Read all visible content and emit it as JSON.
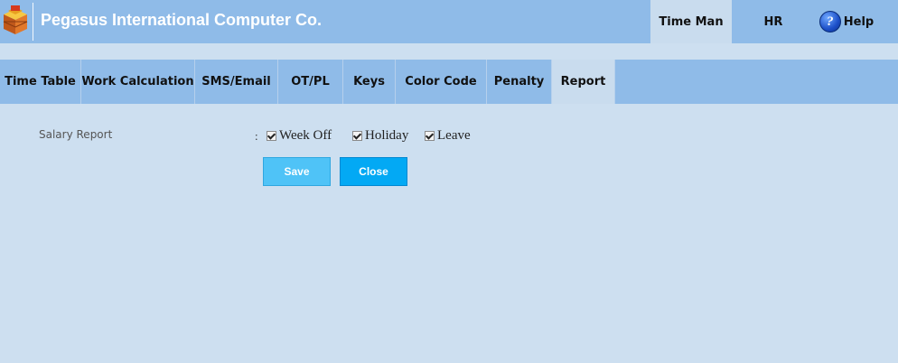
{
  "header": {
    "company_name": "Pegasus International Computer Co.",
    "logo_icon": "stacked-boxes-icon",
    "nav": [
      {
        "label": "Time Man",
        "active": true
      },
      {
        "label": "HR",
        "active": false
      },
      {
        "label": "Help",
        "active": false,
        "icon": "help-icon"
      }
    ]
  },
  "tabs": [
    {
      "label": "Time Table",
      "active": false
    },
    {
      "label": "Work Calculation",
      "active": false
    },
    {
      "label": "SMS/Email",
      "active": false
    },
    {
      "label": "OT/PL",
      "active": false
    },
    {
      "label": "Keys",
      "active": false
    },
    {
      "label": "Color Code",
      "active": false
    },
    {
      "label": "Penalty",
      "active": false
    },
    {
      "label": "Report",
      "active": true
    }
  ],
  "form": {
    "salary_report_label": "Salary Report",
    "separator": ":",
    "options": [
      {
        "label": "Week Off",
        "checked": true
      },
      {
        "label": "Holiday",
        "checked": true
      },
      {
        "label": "Leave",
        "checked": true
      }
    ],
    "save_label": "Save",
    "close_label": "Close"
  },
  "colors": {
    "header_bg": "#8fbbe8",
    "active_tab_bg": "#c9dcee",
    "page_bg": "#cddff0",
    "save_button": "#4fc3f7",
    "close_button": "#03a9f4"
  }
}
